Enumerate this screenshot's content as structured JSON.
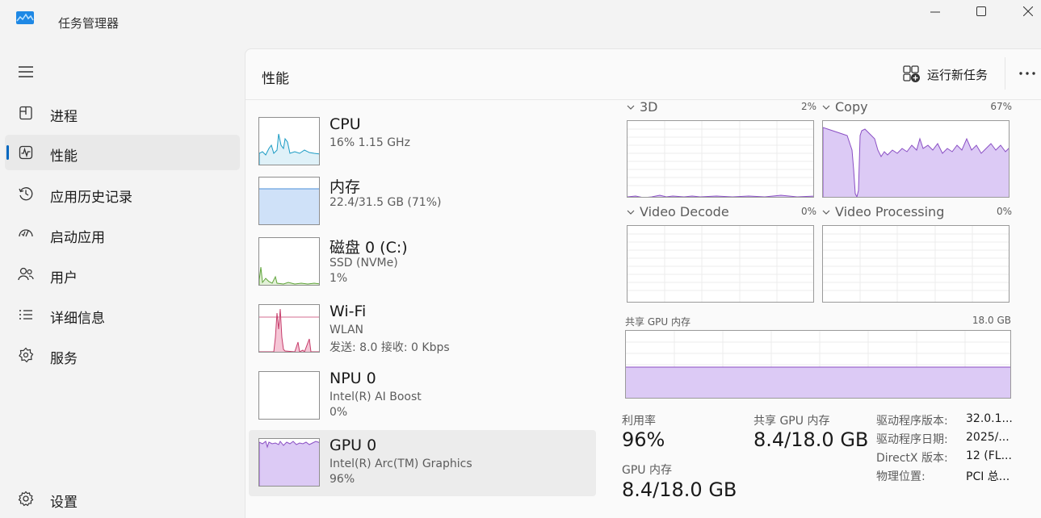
{
  "window": {
    "title": "任务管理器",
    "icons": {
      "logo": "task-manager-logo",
      "minimize": "minimize-icon",
      "maximize": "maximize-icon",
      "close": "close-icon"
    }
  },
  "sidebar": {
    "menu_icon": "hamburger-icon",
    "items": [
      {
        "label": "进程",
        "icon": "processes-icon",
        "active": false
      },
      {
        "label": "性能",
        "icon": "performance-icon",
        "active": true
      },
      {
        "label": "应用历史记录",
        "icon": "history-icon",
        "active": false
      },
      {
        "label": "启动应用",
        "icon": "startup-icon",
        "active": false
      },
      {
        "label": "用户",
        "icon": "users-icon",
        "active": false
      },
      {
        "label": "详细信息",
        "icon": "details-icon",
        "active": false
      },
      {
        "label": "服务",
        "icon": "services-icon",
        "active": false
      }
    ],
    "settings": {
      "label": "设置",
      "icon": "settings-icon"
    }
  },
  "header": {
    "title": "性能",
    "run_task_label": "运行新任务",
    "more_icon": "more-icon"
  },
  "devices": [
    {
      "name": "CPU",
      "sub1": "16% 1.15 GHz",
      "sub2": "",
      "color": "#1c9cc4",
      "fill": "#dff1f8"
    },
    {
      "name": "内存",
      "sub1": "22.4/31.5 GB (71%)",
      "sub2": "",
      "color": "#4b8fd9",
      "fill": "#cfe1f8"
    },
    {
      "name": "磁盘 0 (C:)",
      "sub1": "SSD (NVMe)",
      "sub2": "1%",
      "color": "#5fa33a",
      "fill": "#e2f1d7"
    },
    {
      "name": "Wi-Fi",
      "sub1": "WLAN",
      "sub2": "发送: 8.0 接收: 0 Kbps",
      "color": "#c63d6b",
      "fill": "#f5c6d6"
    },
    {
      "name": "NPU 0",
      "sub1": "Intel(R) AI Boost",
      "sub2": "0%",
      "color": "#8a8a8a",
      "fill": "#ffffff"
    },
    {
      "name": "GPU 0",
      "sub1": "Intel(R) Arc(TM) Graphics",
      "sub2": "96%",
      "color": "#8a4fc4",
      "fill": "#dccaf5",
      "selected": true
    }
  ],
  "gpu": {
    "engines": [
      {
        "name": "3D",
        "pct": "2%"
      },
      {
        "name": "Copy",
        "pct": "67%"
      },
      {
        "name": "Video Decode",
        "pct": "0%"
      },
      {
        "name": "Video Processing",
        "pct": "0%"
      }
    ],
    "shared_mem_label": "共享 GPU 内存",
    "shared_mem_max": "18.0 GB",
    "stats": {
      "utilization_label": "利用率",
      "utilization_value": "96%",
      "shared_label": "共享 GPU 内存",
      "shared_value": "8.4/18.0 GB",
      "gpu_mem_label": "GPU 内存",
      "gpu_mem_value": "8.4/18.0 GB"
    },
    "info": [
      {
        "k": "驱动程序版本:",
        "v": "32.0.1..."
      },
      {
        "k": "驱动程序日期:",
        "v": "2025/..."
      },
      {
        "k": "DirectX 版本:",
        "v": "12 (FL..."
      },
      {
        "k": "物理位置:",
        "v": "PCI 总..."
      }
    ]
  }
}
